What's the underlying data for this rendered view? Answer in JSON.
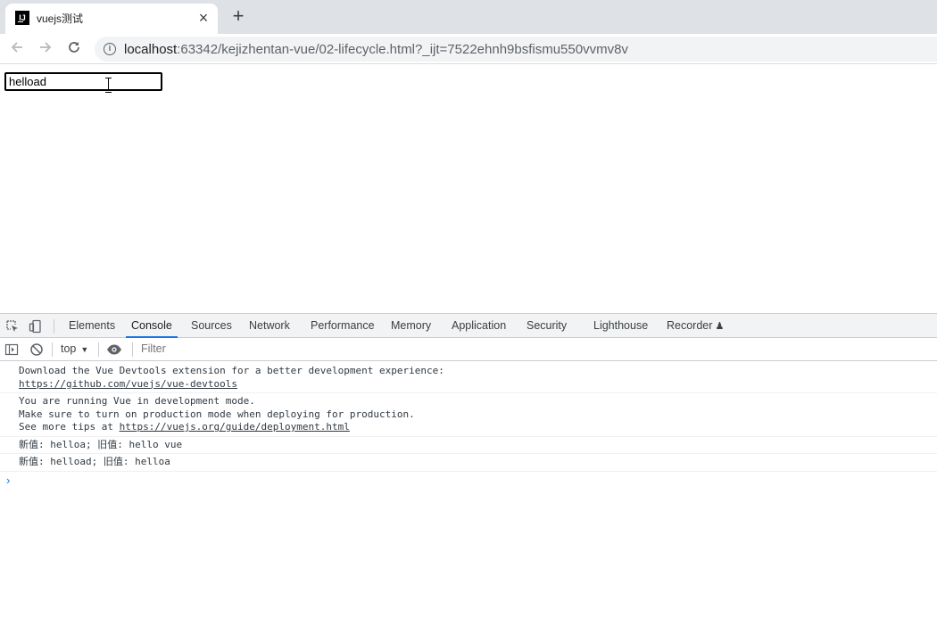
{
  "browser": {
    "tab": {
      "title": "vuejs测试",
      "favicon_text": "IJ",
      "close_icon": "close-icon"
    },
    "new_tab_icon": "plus-icon",
    "nav": {
      "back_icon": "arrow-left-icon",
      "forward_icon": "arrow-right-icon",
      "reload_icon": "reload-icon"
    },
    "address": {
      "host": "localhost",
      "rest": ":63342/kejizhentan-vue/02-lifecycle.html?_ijt=7522ehnh9bsfismu550vvmv8v"
    }
  },
  "page": {
    "input_value": "helload"
  },
  "devtools": {
    "tabs": [
      "Elements",
      "Console",
      "Sources",
      "Network",
      "Performance",
      "Memory",
      "Application",
      "Security",
      "Lighthouse",
      "Recorder"
    ],
    "active_tab": "Console",
    "context": "top",
    "filter_placeholder": "Filter",
    "messages": [
      {
        "lines": [
          "Download the Vue Devtools extension for a better development experience:"
        ],
        "link": "https://github.com/vuejs/vue-devtools",
        "link_prefix": ""
      },
      {
        "lines": [
          "You are running Vue in development mode.",
          "Make sure to turn on production mode when deploying for production."
        ],
        "link": "https://vuejs.org/guide/deployment.html",
        "link_prefix": "See more tips at "
      },
      {
        "lines": [
          "新值: helloa; 旧值: hello vue"
        ]
      },
      {
        "lines": [
          "新值: helload; 旧值: helloa"
        ]
      }
    ],
    "prompt_icon": "chevron-right-icon"
  },
  "colors": {
    "accent": "#1a73e8",
    "tabstrip": "#dee1e6"
  }
}
